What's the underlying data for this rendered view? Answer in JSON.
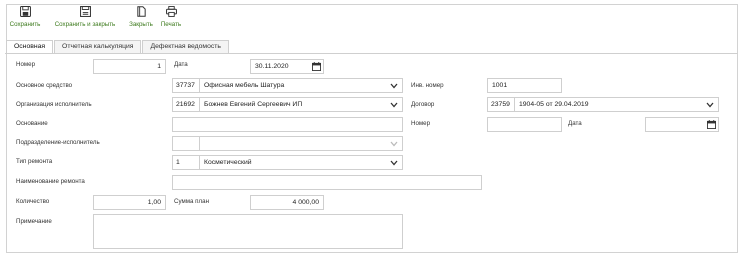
{
  "toolbar": {
    "save": "Сохранить",
    "save_close": "Сохранить и закрыть",
    "close": "Закрыть",
    "print": "Печать"
  },
  "tabs": [
    "Основная",
    "Отчетная калькуляция",
    "Дефектная ведомость"
  ],
  "form": {
    "number_label": "Номер",
    "number_value": "1",
    "date_label": "Дата",
    "date_value": "30.11.2020",
    "asset_label": "Основное средство",
    "asset_code": "37737",
    "asset_name": "Офисная мебель Шатура",
    "inv_label": "Инв. номер",
    "inv_value": "1001",
    "org_label": "Организация исполнитель",
    "org_code": "21692",
    "org_name": "Божнев Евгений Сергеевич ИП",
    "contract_label": "Договор",
    "contract_code": "23759",
    "contract_name": "1904-05 от 29.04.2019",
    "basis_label": "Основание",
    "basis_value": "",
    "basis_num_label": "Номер",
    "basis_num_value": "",
    "basis_date_label": "Дата",
    "basis_date_value": "",
    "dept_label": "Подразделение-исполнитель",
    "dept_code": "",
    "dept_name": "",
    "repair_type_label": "Тип ремонта",
    "repair_type_code": "1",
    "repair_type_name": "Косметический",
    "repair_name_label": "Наименование ремонта",
    "repair_name_value": "",
    "qty_label": "Количество",
    "qty_value": "1,00",
    "sum_label": "Сумма план",
    "sum_value": "4 000,00",
    "note_label": "Примечание",
    "note_value": ""
  }
}
